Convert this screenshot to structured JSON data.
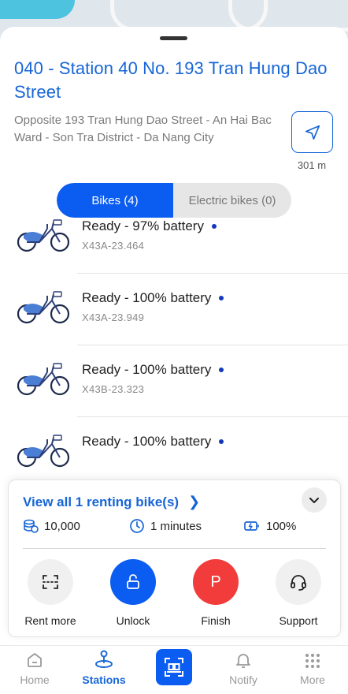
{
  "station": {
    "title": "040 - Station 40 No. 193 Tran Hung Dao Street",
    "address": "Opposite 193 Tran Hung Dao Street - An Hai Bac Ward - Son Tra District - Da Nang City",
    "distance": "301 m"
  },
  "segment": {
    "tabs": [
      {
        "label": "Bikes (4)",
        "active": true
      },
      {
        "label": "Electric bikes (0)",
        "active": false
      }
    ]
  },
  "bikes": [
    {
      "status": "Ready - 97% battery",
      "code": "X43A-23.464"
    },
    {
      "status": "Ready - 100% battery",
      "code": "X43A-23.949"
    },
    {
      "status": "Ready - 100% battery",
      "code": "X43B-23.323"
    },
    {
      "status": "Ready - 100% battery",
      "code": ""
    }
  ],
  "renting": {
    "header": "View all 1 renting bike(s)",
    "points": "10,000",
    "duration": "1 minutes",
    "battery": "100%"
  },
  "actions": [
    {
      "label": "Rent more",
      "icon": "scan-icon"
    },
    {
      "label": "Unlock",
      "icon": "unlock-icon"
    },
    {
      "label": "Finish",
      "icon": "parking-icon",
      "glyph": "P"
    },
    {
      "label": "Support",
      "icon": "headset-icon"
    }
  ],
  "tabbar": {
    "items": [
      {
        "label": "Home",
        "icon": "home-icon"
      },
      {
        "label": "Stations",
        "icon": "station-pin-icon",
        "active": true
      },
      {
        "label": "",
        "icon": "qr-scan-icon"
      },
      {
        "label": "Notify",
        "icon": "bell-icon"
      },
      {
        "label": "More",
        "icon": "grid-dots-icon"
      }
    ]
  },
  "colors": {
    "accent": "#1766d6",
    "primary_button": "#0b5cf0",
    "finish": "#f23c3c",
    "battery_dot": "#1238b8"
  }
}
